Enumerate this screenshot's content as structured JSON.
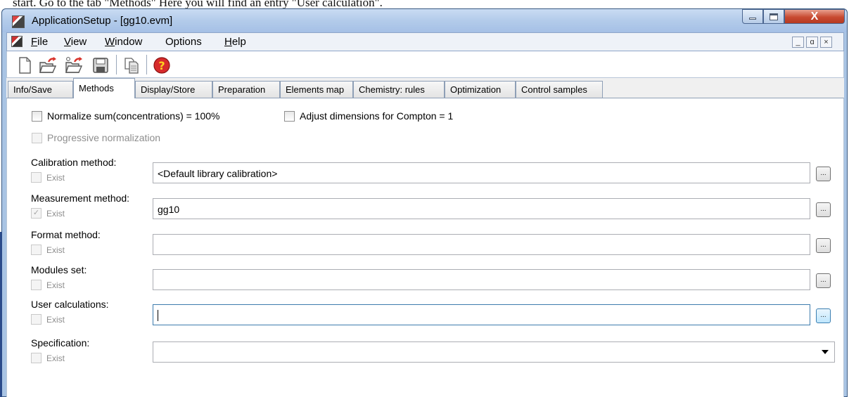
{
  "caption": "start. Go to the tab \"Methods\" Here you will find an entry \"User calculation\".",
  "window": {
    "title": "ApplicationSetup - [gg10.evm]",
    "controls": {
      "close": "X"
    }
  },
  "menu": {
    "items": [
      {
        "label": "File",
        "underline": "F",
        "rest": "ile"
      },
      {
        "label": "View",
        "underline": "V",
        "rest": "iew"
      },
      {
        "label": "Window",
        "underline": "W",
        "rest": "indow"
      },
      {
        "label": "Options",
        "underline": "",
        "rest": "Options"
      },
      {
        "label": "Help",
        "underline": "H",
        "rest": "elp"
      }
    ],
    "mdi_controls": [
      "_",
      "ɑ",
      "×"
    ]
  },
  "toolbar": {
    "buttons": [
      "new-document-icon",
      "open-icon",
      "open-recent-icon",
      "save-icon",
      "copy-icon",
      "help-icon"
    ]
  },
  "tabs": [
    {
      "label": "Info/Save",
      "active": false
    },
    {
      "label": "Methods",
      "active": true
    },
    {
      "label": "Display/Store",
      "active": false
    },
    {
      "label": "Preparation",
      "active": false
    },
    {
      "label": "Elements map",
      "active": false
    },
    {
      "label": "Chemistry: rules",
      "active": false
    },
    {
      "label": "Optimization",
      "active": false
    },
    {
      "label": "Control samples",
      "active": false
    }
  ],
  "options": {
    "normalize": {
      "label": "Normalize sum(concentrations) = 100%",
      "checked": false
    },
    "adjust": {
      "label": "Adjust dimensions for Compton = 1",
      "checked": false
    },
    "progressive": {
      "label": "Progressive normalization",
      "checked": false,
      "disabled": true
    }
  },
  "fields": [
    {
      "label": "Calibration method:",
      "exist_label": "Exist",
      "exist_checked": false,
      "value": "<Default library calibration>",
      "button": "..."
    },
    {
      "label": "Measurement method:",
      "exist_label": "Exist",
      "exist_checked": true,
      "value": "gg10",
      "button": "..."
    },
    {
      "label": "Format method:",
      "exist_label": "Exist",
      "exist_checked": false,
      "value": "",
      "button": "..."
    },
    {
      "label": "Modules set:",
      "exist_label": "Exist",
      "exist_checked": false,
      "value": "",
      "button": "..."
    },
    {
      "label": "User calculations:",
      "exist_label": "Exist",
      "exist_checked": false,
      "value": "",
      "button": "..."
    },
    {
      "label": "Specification:",
      "exist_label": "Exist",
      "exist_checked": false,
      "value": ""
    }
  ],
  "colors": {
    "title_bar": "#b3cbea",
    "close_button": "#c84a31",
    "focus_border": "#3d7bad"
  }
}
